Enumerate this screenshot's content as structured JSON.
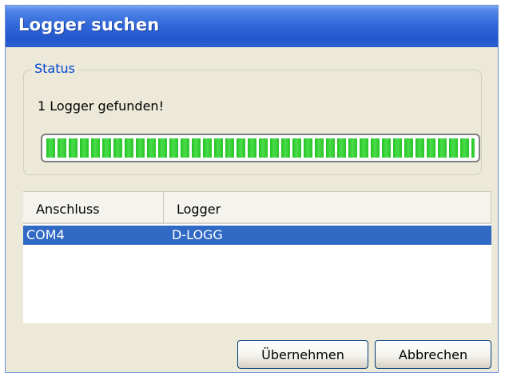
{
  "window": {
    "title": "Logger suchen"
  },
  "status": {
    "legend": "Status",
    "message": "1 Logger gefunden!",
    "progress_percent": 100
  },
  "list": {
    "columns": [
      "Anschluss",
      "Logger"
    ],
    "rows": [
      {
        "anschluss": "COM4",
        "logger": "D-LOGG",
        "selected": true
      }
    ]
  },
  "buttons": {
    "apply_label": "Übernehmen",
    "cancel_label": "Abbrechen"
  },
  "colors": {
    "titlebar": "#2457cc",
    "selection": "#316ac5",
    "progress": "#2ec82e",
    "legend": "#0046d5"
  }
}
